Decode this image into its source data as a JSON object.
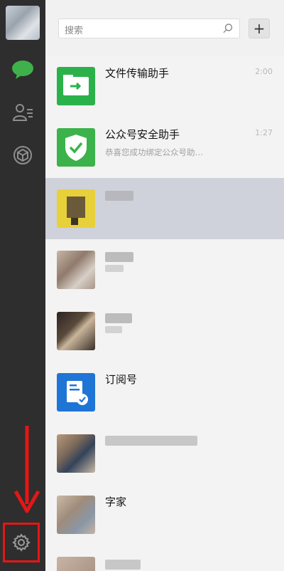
{
  "search": {
    "placeholder": "搜索"
  },
  "add_button": {
    "label": "+"
  },
  "chats": [
    {
      "title": "文件传输助手",
      "time": "2:00",
      "preview": ""
    },
    {
      "title": "公众号安全助手",
      "time": "1:27",
      "preview": "恭喜您成功绑定公众号助…"
    },
    {
      "title": "",
      "time": "",
      "preview": ""
    },
    {
      "title": "",
      "time": "",
      "preview": ""
    },
    {
      "title": "",
      "time": "",
      "preview": ""
    },
    {
      "title": "订阅号",
      "time": "",
      "preview": ""
    },
    {
      "title": "",
      "time": "",
      "preview": ""
    },
    {
      "title": "字家",
      "time": "",
      "preview": ""
    }
  ],
  "icons": {
    "chat": "chat-bubble-icon",
    "contacts": "contacts-icon",
    "favorites": "cube-icon",
    "settings": "gear-icon"
  },
  "colors": {
    "sidebar": "#2e2e2e",
    "accent_green": "#3fb14b",
    "highlight_red": "#e51616",
    "selected_row": "#cfd2da"
  }
}
